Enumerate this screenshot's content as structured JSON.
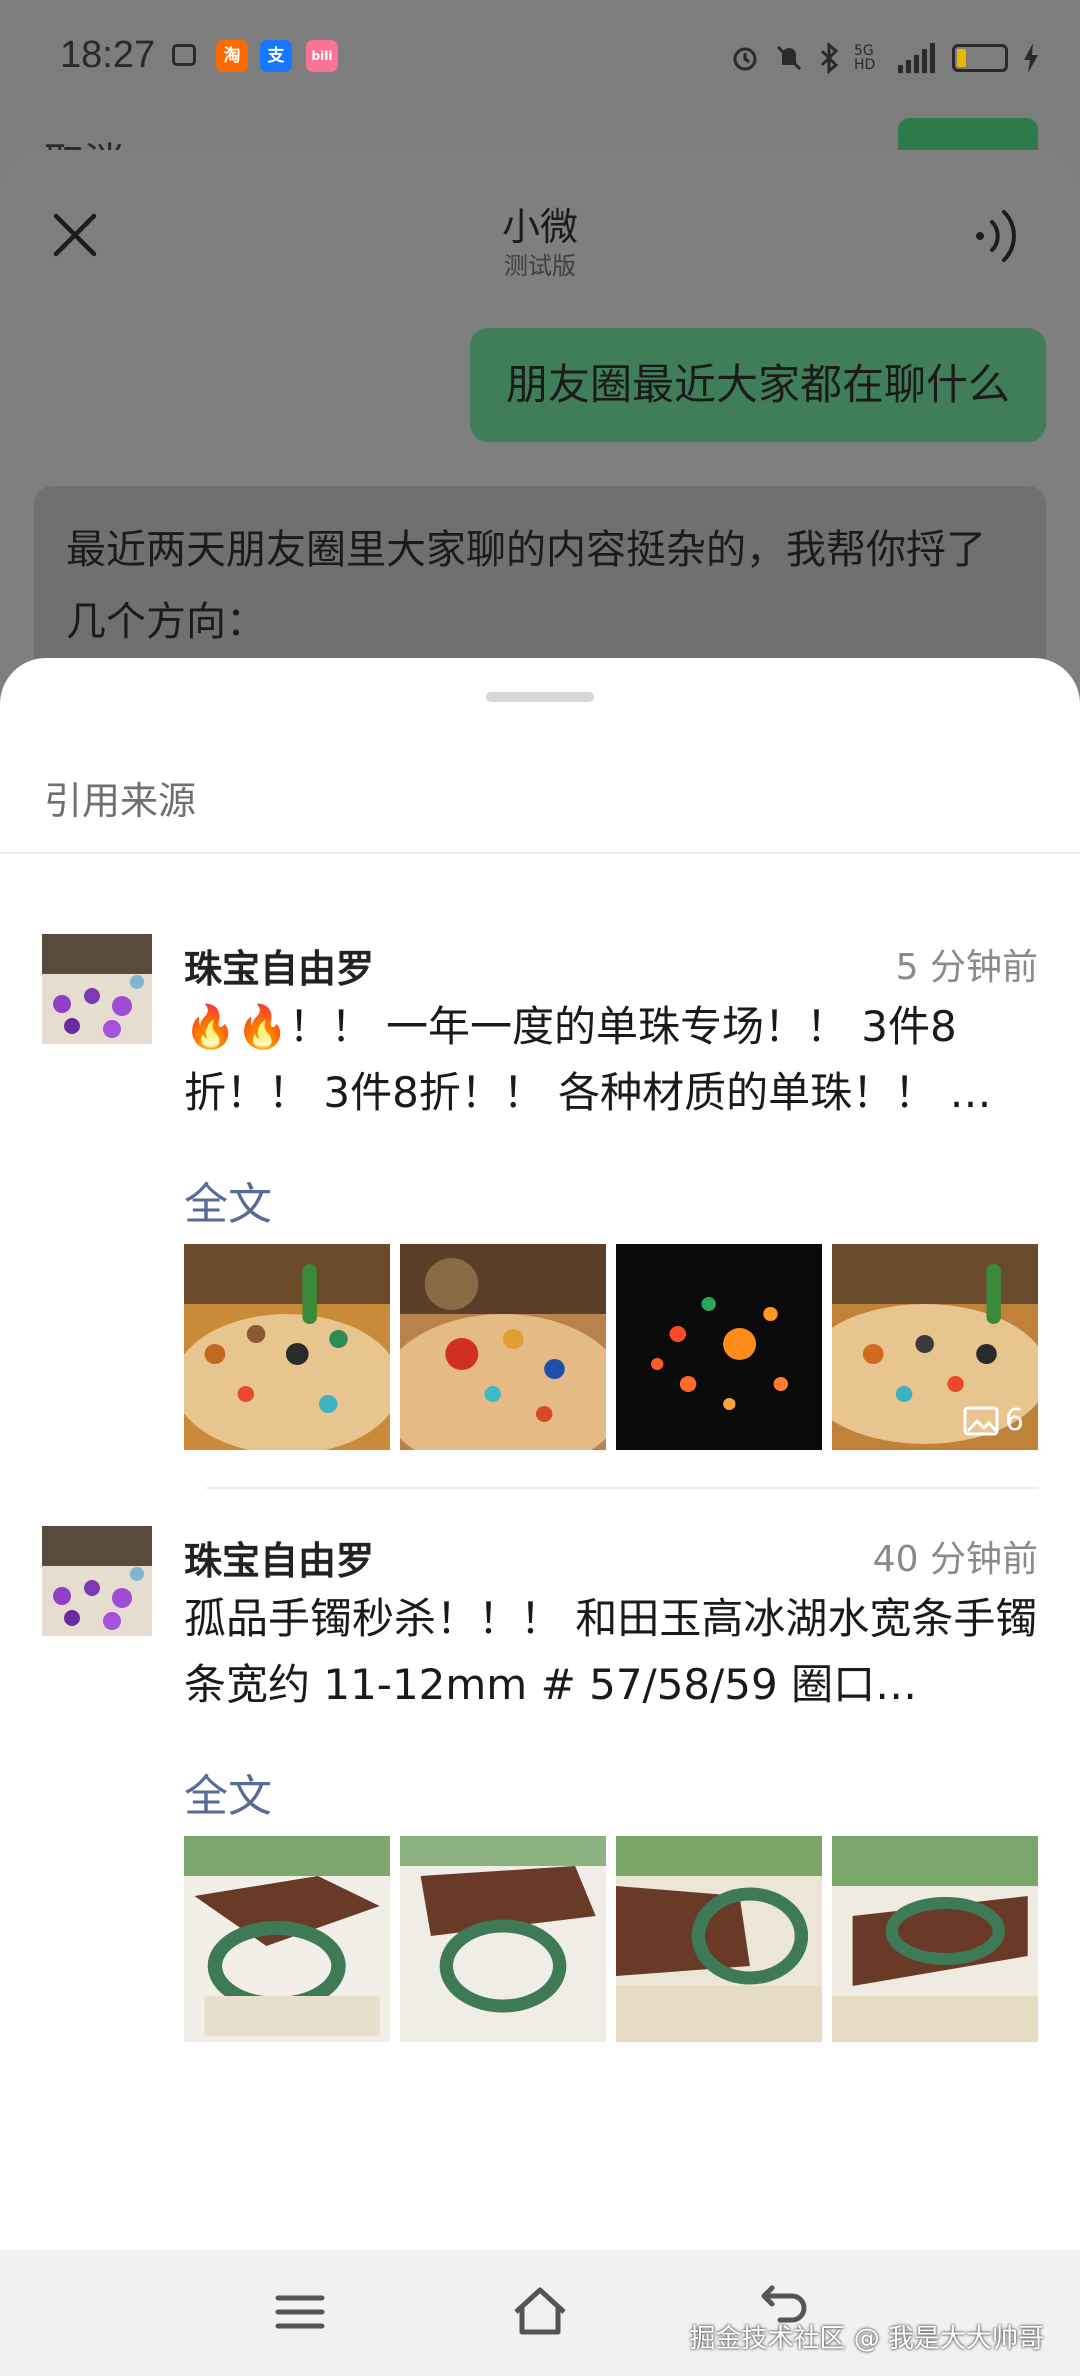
{
  "status_bar": {
    "time": "18:27",
    "app_icons": [
      {
        "name": "taobao-icon",
        "glyph": "淘",
        "color": "#ff6a00"
      },
      {
        "name": "alipay-icon",
        "glyph": "支",
        "color": "#1677ff"
      },
      {
        "name": "bilibili-icon",
        "glyph": "bili",
        "color": "#fb7299"
      }
    ],
    "network": "5G HD"
  },
  "background": {
    "left_text": "取消",
    "right_button_color": "#2d7a4a"
  },
  "chat": {
    "title": "小微",
    "subtitle": "测试版",
    "user_message": "朋友圈最近大家都在聊什么",
    "bot_message": "最近两天朋友圈里大家聊的内容挺杂的，我帮你捋了几个方向："
  },
  "sheet": {
    "title": "引用来源",
    "posts": [
      {
        "author": "珠宝自由罗",
        "time": "5 分钟前",
        "text": "🔥🔥！！ 一年一度的单珠专场！！ 3件8折！！ 3件8折！！ 各种材质的单珠！！ …",
        "full_link": "全文",
        "image_count": "6"
      },
      {
        "author": "珠宝自由罗",
        "time": "40 分钟前",
        "text": "孤品手镯秒杀！！！ 和田玉高冰湖水宽条手镯 条宽约 11-12mm # 57/58/59 圈口…",
        "full_link": "全文"
      }
    ]
  },
  "watermark": "掘金技术社区 @ 我是大大帅哥",
  "colors": {
    "accent_link": "#576b95",
    "user_bubble": "#3f7e58"
  }
}
